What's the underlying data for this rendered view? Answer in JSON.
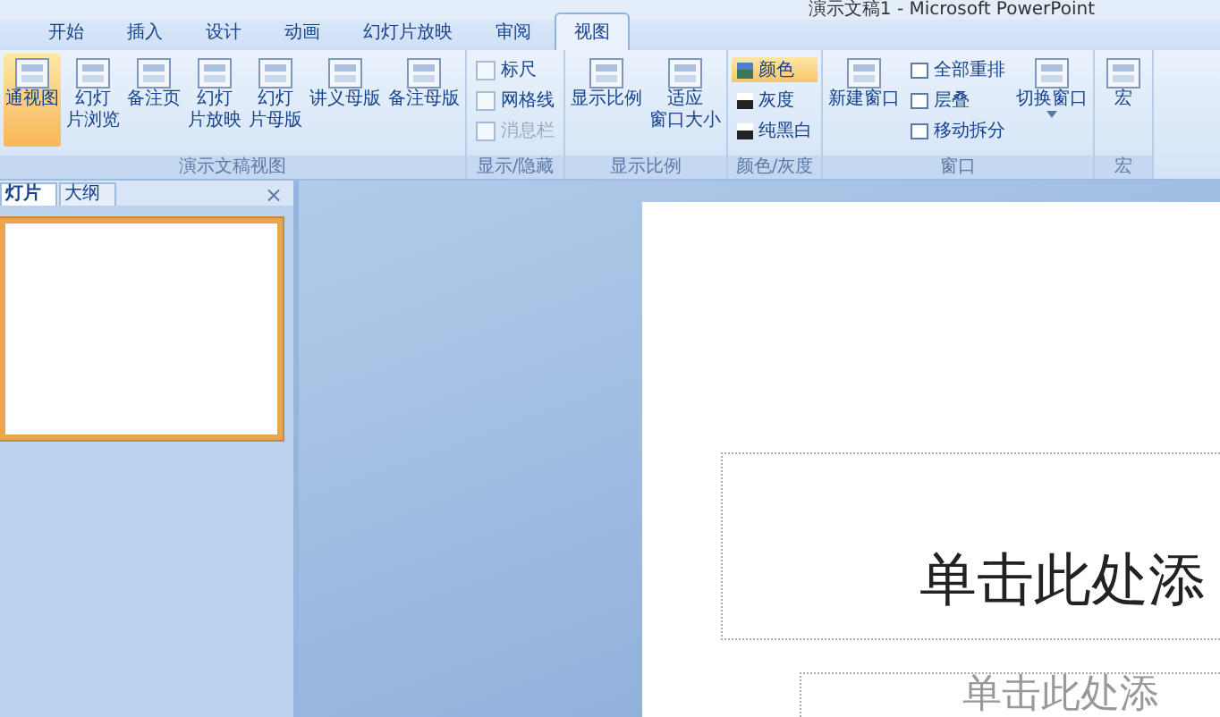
{
  "window": {
    "title": "演示文稿1 - Microsoft PowerPoint"
  },
  "tabs": [
    {
      "label": "开始",
      "selected": false
    },
    {
      "label": "插入",
      "selected": false
    },
    {
      "label": "设计",
      "selected": false
    },
    {
      "label": "动画",
      "selected": false
    },
    {
      "label": "幻灯片放映",
      "selected": false
    },
    {
      "label": "审阅",
      "selected": false
    },
    {
      "label": "视图",
      "selected": true
    }
  ],
  "ribbon": {
    "groups": [
      {
        "label": "演示文稿视图",
        "kind": "buttons",
        "items": [
          {
            "lines": [
              "通视图"
            ],
            "selected": true
          },
          {
            "lines": [
              "幻灯",
              "片浏览"
            ],
            "selected": false
          },
          {
            "lines": [
              "备注页"
            ],
            "selected": false
          },
          {
            "lines": [
              "幻灯",
              "片放映"
            ],
            "selected": false
          },
          {
            "lines": [
              "幻灯",
              "片母版"
            ],
            "selected": false
          },
          {
            "lines": [
              "讲义母版"
            ],
            "selected": false
          },
          {
            "lines": [
              "备注母版"
            ],
            "selected": false
          }
        ]
      },
      {
        "label": "显示/隐藏",
        "kind": "checks",
        "items": [
          {
            "label": "标尺",
            "checked": false,
            "disabled": false
          },
          {
            "label": "网格线",
            "checked": false,
            "disabled": false
          },
          {
            "label": "消息栏",
            "checked": false,
            "disabled": true
          }
        ]
      },
      {
        "label": "显示比例",
        "kind": "buttons",
        "items": [
          {
            "lines": [
              "显示比例"
            ],
            "selected": false
          },
          {
            "lines": [
              "适应",
              "窗口大小"
            ],
            "selected": false
          }
        ]
      },
      {
        "label": "颜色/灰度",
        "kind": "colors",
        "items": [
          {
            "label": "颜色",
            "selected": true
          },
          {
            "label": "灰度",
            "selected": false
          },
          {
            "label": "纯黑白",
            "selected": false
          }
        ]
      },
      {
        "label": "窗口",
        "kind": "window",
        "items": [
          {
            "lines": [
              "新建窗口"
            ],
            "selected": false
          }
        ],
        "small": [
          "全部重排",
          "层叠",
          "移动拆分"
        ],
        "more": [
          {
            "lines": [
              "切换窗口"
            ],
            "selected": false,
            "dropdown": true
          }
        ]
      },
      {
        "label": "宏",
        "kind": "buttons",
        "items": [
          {
            "lines": [
              "宏"
            ],
            "selected": false
          }
        ]
      }
    ]
  },
  "pane": {
    "tabs": [
      {
        "label": "灯片",
        "selected": true
      },
      {
        "label": "大纲",
        "selected": false
      }
    ],
    "close": "×"
  },
  "slide": {
    "title_placeholder": "单击此处添",
    "subtitle_placeholder": "单击此处添"
  }
}
